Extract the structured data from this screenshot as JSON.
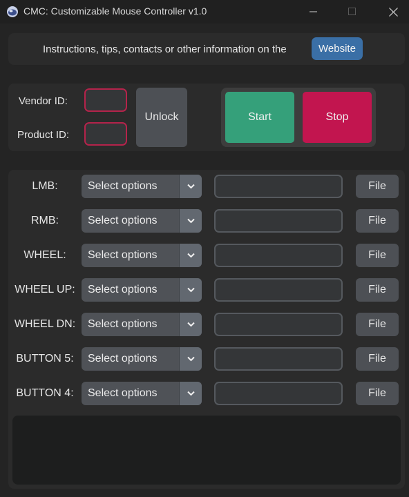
{
  "window": {
    "title": "CMC: Customizable Mouse Controller v1.0",
    "icon": "mouse-app-icon"
  },
  "info": {
    "text": "Instructions, tips, contacts or other information on the",
    "website_label": "Website"
  },
  "device": {
    "vendor_label": "Vendor ID:",
    "vendor_value": "",
    "product_label": "Product ID:",
    "product_value": "",
    "unlock_label": "Unlock"
  },
  "controls": {
    "start_label": "Start",
    "stop_label": "Stop"
  },
  "mappings": [
    {
      "label": "LMB:",
      "selected": "Select options",
      "file_label": "File",
      "path": ""
    },
    {
      "label": "RMB:",
      "selected": "Select options",
      "file_label": "File",
      "path": ""
    },
    {
      "label": "WHEEL:",
      "selected": "Select options",
      "file_label": "File",
      "path": ""
    },
    {
      "label": "WHEEL UP:",
      "selected": "Select options",
      "file_label": "File",
      "path": ""
    },
    {
      "label": "WHEEL DN:",
      "selected": "Select options",
      "file_label": "File",
      "path": ""
    },
    {
      "label": "BUTTON 5:",
      "selected": "Select options",
      "file_label": "File",
      "path": ""
    },
    {
      "label": "BUTTON 4:",
      "selected": "Select options",
      "file_label": "File",
      "path": ""
    }
  ],
  "log": {
    "text": ""
  },
  "colors": {
    "background": "#242424",
    "frame": "#2b2b2b",
    "accent_blue": "#3a6fa6",
    "start_green": "#35a07a",
    "stop_red": "#c2154f",
    "invalid_border": "#b5234b"
  }
}
